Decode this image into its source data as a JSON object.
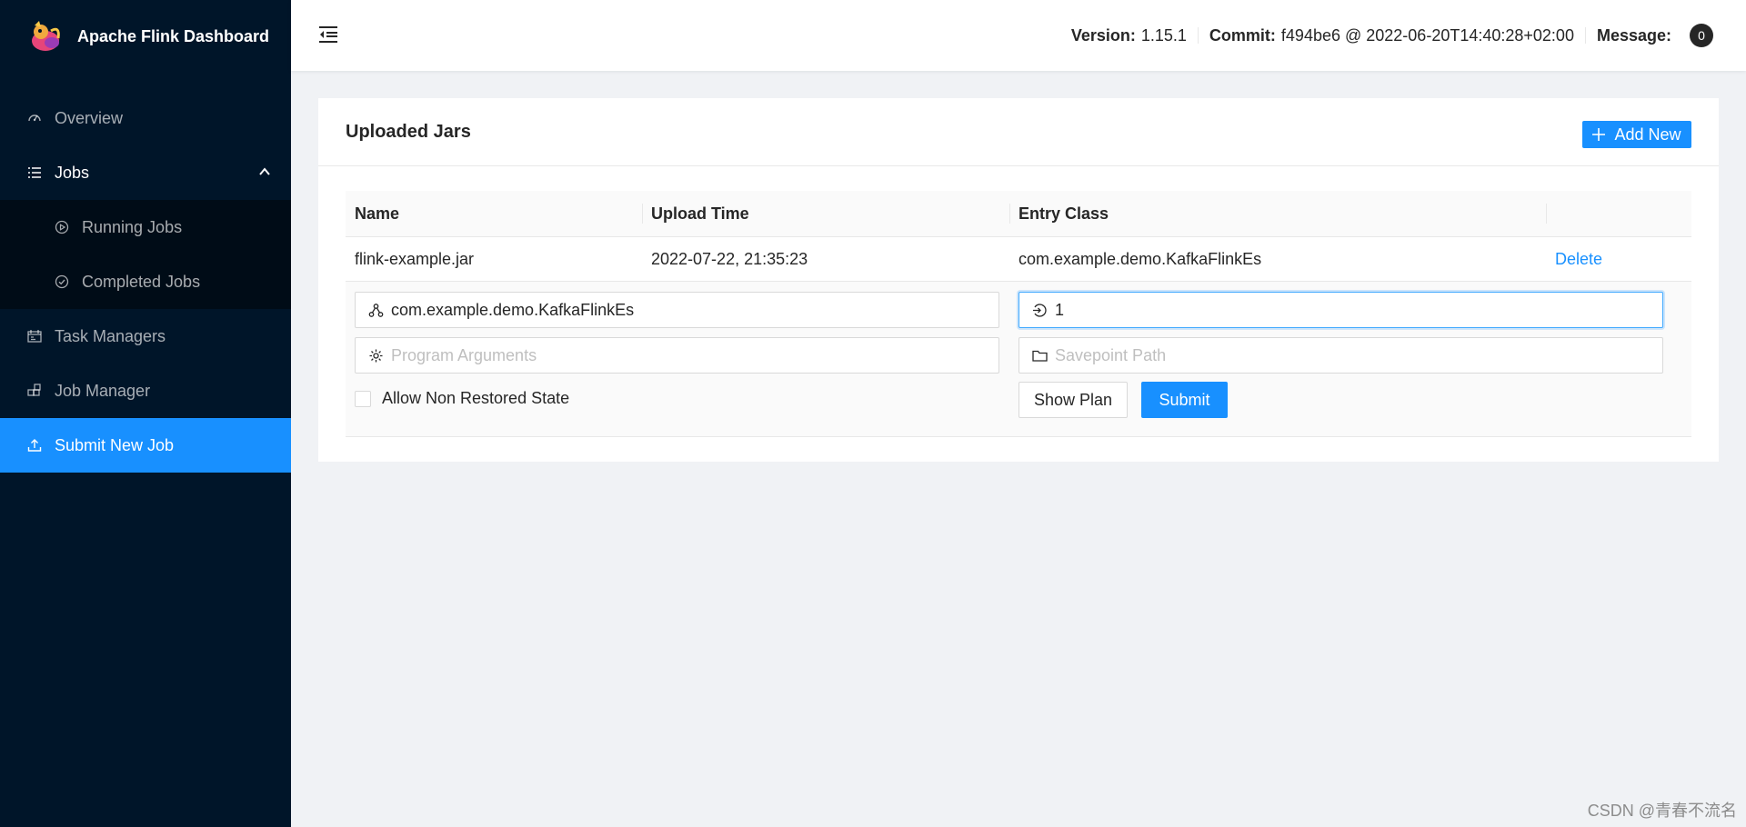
{
  "app": {
    "title": "Apache Flink Dashboard",
    "logo_icon": "flink-squirrel-logo"
  },
  "sidebar": {
    "items": [
      {
        "label": "Overview",
        "icon": "dashboard-icon"
      },
      {
        "label": "Jobs",
        "icon": "unordered-list-icon",
        "expanded": true,
        "children": [
          {
            "label": "Running Jobs",
            "icon": "play-circle-icon"
          },
          {
            "label": "Completed Jobs",
            "icon": "check-circle-icon"
          }
        ]
      },
      {
        "label": "Task Managers",
        "icon": "schedule-icon"
      },
      {
        "label": "Job Manager",
        "icon": "build-icon"
      },
      {
        "label": "Submit New Job",
        "icon": "upload-icon",
        "active": true
      }
    ]
  },
  "header": {
    "version_label": "Version:",
    "version": "1.15.1",
    "commit_label": "Commit:",
    "commit": "f494be6 @ 2022-06-20T14:40:28+02:00",
    "message_label": "Message:",
    "message_count": "0"
  },
  "card": {
    "title": "Uploaded Jars",
    "add_button": "Add New"
  },
  "table": {
    "columns": [
      "Name",
      "Upload Time",
      "Entry Class"
    ],
    "rows": [
      {
        "name": "flink-example.jar",
        "upload_time": "2022-07-22, 21:35:23",
        "entry_class": "com.example.demo.KafkaFlinkEs",
        "action": "Delete"
      }
    ]
  },
  "form": {
    "entry_class_value": "com.example.demo.KafkaFlinkEs",
    "parallelism_value": "1",
    "program_args_placeholder": "Program Arguments",
    "savepoint_placeholder": "Savepoint Path",
    "allow_non_restored_label": "Allow Non Restored State",
    "allow_non_restored_checked": false,
    "show_plan_button": "Show Plan",
    "submit_button": "Submit"
  },
  "watermark": "CSDN @青春不流名",
  "colors": {
    "sidebar_bg": "#001529",
    "submenu_bg": "#000c17",
    "accent": "#1890ff",
    "page_bg": "#f0f2f5"
  }
}
